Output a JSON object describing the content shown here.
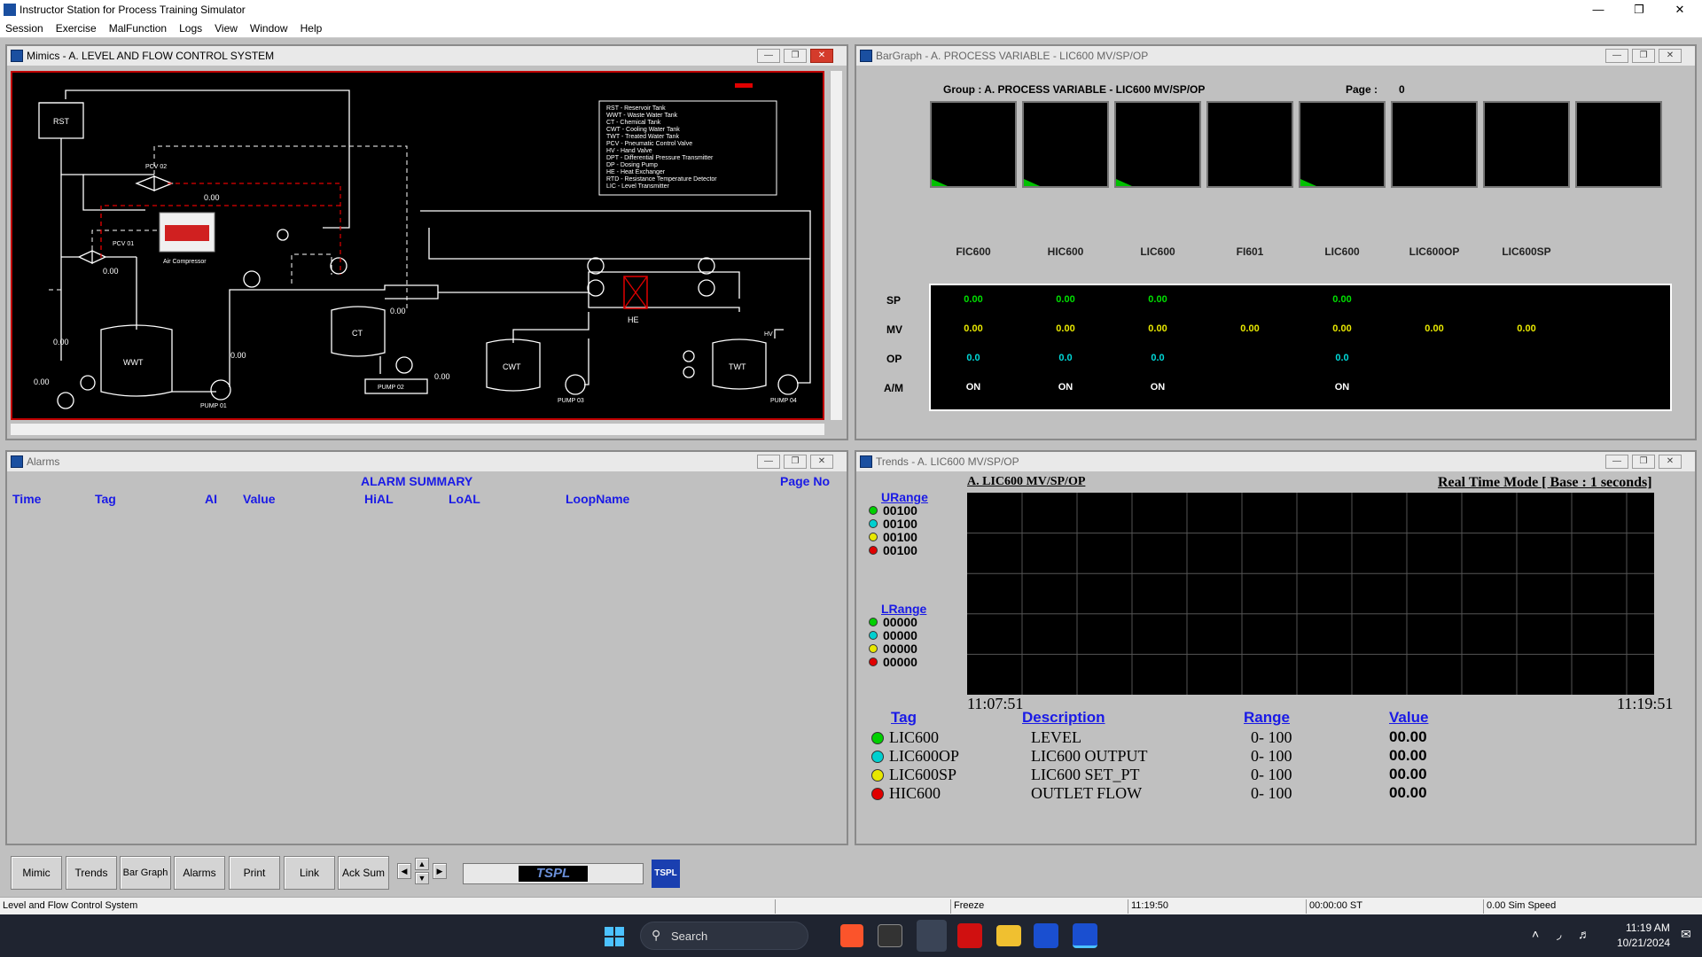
{
  "app": {
    "title": "Instructor Station for Process Training Simulator"
  },
  "menu": [
    "Session",
    "Exercise",
    "MalFunction",
    "Logs",
    "View",
    "Window",
    "Help"
  ],
  "mimic": {
    "window_title": "Mimics - A. LEVEL AND FLOW CONTROL SYSTEM",
    "legend": [
      "RST - Reservoir Tank",
      "WWT - Waste Water Tank",
      "CT - Chemical Tank",
      "CWT - Cooling Water Tank",
      "TWT - Treated Water Tank",
      "PCV - Pneumatic Control Valve",
      "HV - Hand Valve",
      "DPT - Differential Pressure Transmitter",
      "DP - Dosing Pump",
      "HE - Heat Exchanger",
      "RTD - Resistance Temperature Detector",
      "LIC - Level Transmitter"
    ],
    "labels": {
      "rst": "RST",
      "wwt": "WWT",
      "ct": "CT",
      "cwt": "CWT",
      "twt": "TWT",
      "he": "HE",
      "pcv01": "PCV 01",
      "pcv02": "PCV 02",
      "compressor": "Air Compressor",
      "pump01": "PUMP 01",
      "pump02": "PUMP 02",
      "pump03": "PUMP 03",
      "pump04": "PUMP 04",
      "hv": "HV"
    },
    "values": {
      "v1": "0.00",
      "v2": "0.00",
      "v3": "0.00",
      "v4": "0.00",
      "v5": "0.00",
      "v6": "0.00",
      "v7": "0.00",
      "v8": "0.00"
    }
  },
  "bargraph": {
    "window_title": "BarGraph - A. PROCESS VARIABLE - LIC600 MV/SP/OP",
    "group_label": "Group : A. PROCESS VARIABLE - LIC600 MV/SP/OP",
    "page_label": "Page :",
    "page_value": "0",
    "row_labels": [
      "SP",
      "MV",
      "OP",
      "A/M"
    ],
    "tags": [
      "FIC600",
      "HIC600",
      "LIC600",
      "FI601",
      "LIC600",
      "LIC600OP",
      "LIC600SP",
      ""
    ],
    "sp": [
      "0.00",
      "0.00",
      "0.00",
      "",
      "0.00",
      "",
      "",
      ""
    ],
    "mv": [
      "0.00",
      "0.00",
      "0.00",
      "0.00",
      "0.00",
      "0.00",
      "0.00",
      ""
    ],
    "op": [
      "0.0",
      "0.0",
      "0.0",
      "",
      "0.0",
      "",
      "",
      ""
    ],
    "am": [
      "ON",
      "ON",
      "ON",
      "",
      "ON",
      "",
      "",
      ""
    ]
  },
  "alarms": {
    "window_title": "Alarms",
    "summary_title": "ALARM SUMMARY",
    "page_no": "Page No",
    "columns": [
      "Time",
      "Tag",
      "AI",
      "Value",
      "HiAL",
      "LoAL",
      "LoopName"
    ]
  },
  "trends": {
    "window_title": "Trends - A. LIC600 MV/SP/OP",
    "group": "A. LIC600 MV/SP/OP",
    "mode": "Real Time Mode [ Base : 1 seconds]",
    "urange_label": "URange",
    "urange": [
      "00100",
      "00100",
      "00100",
      "00100"
    ],
    "lrange_label": "LRange",
    "lrange": [
      "00000",
      "00000",
      "00000",
      "00000"
    ],
    "t_start": "11:07:51",
    "t_end": "11:19:51",
    "table_headers": [
      "Tag",
      "Description",
      "Range",
      "Value"
    ],
    "rows": [
      {
        "tag": "LIC600",
        "desc": "LEVEL",
        "range": "0- 100",
        "value": "00.00"
      },
      {
        "tag": "LIC600OP",
        "desc": "LIC600 OUTPUT",
        "range": "0- 100",
        "value": "00.00"
      },
      {
        "tag": "LIC600SP",
        "desc": "LIC600 SET_PT",
        "range": "0- 100",
        "value": "00.00"
      },
      {
        "tag": "HIC600",
        "desc": "OUTLET FLOW",
        "range": "0- 100",
        "value": "00.00"
      }
    ],
    "colors": [
      "#00d000",
      "#00d0d0",
      "#e8e800",
      "#e00000"
    ]
  },
  "toolbar": {
    "buttons": [
      "Mimic",
      "Trends",
      "Bar Graph",
      "Alarms",
      "Print",
      "Link",
      "Ack Sum"
    ],
    "logo": "TSPL"
  },
  "status": {
    "left": "Level and Flow Control System",
    "freeze": "Freeze",
    "time": "11:19:50",
    "sim_time": "00:00:00 ST",
    "speed": "0.00 Sim Speed"
  },
  "taskbar": {
    "search": "Search",
    "clock_time": "11:19 AM",
    "clock_date": "10/21/2024"
  }
}
